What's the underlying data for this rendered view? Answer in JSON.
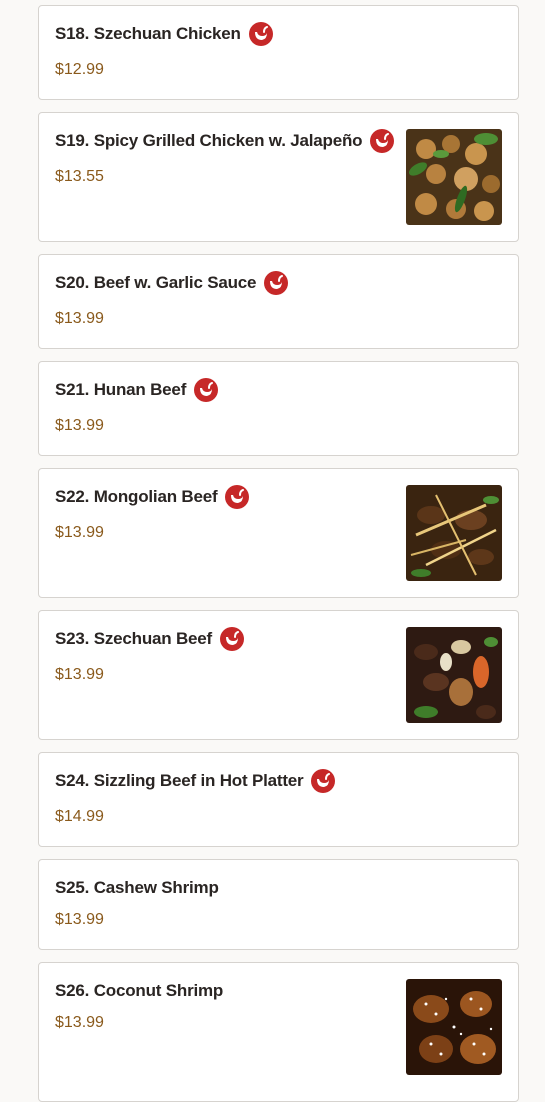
{
  "colors": {
    "accent_price": "#8a5a1c",
    "spicy_red": "#c62828",
    "title": "#2a2523"
  },
  "items": [
    {
      "title": "S18. Szechuan Chicken",
      "price": "$12.99",
      "spicy": true,
      "image": false
    },
    {
      "title": "S19. Spicy Grilled Chicken w. Jalapeño",
      "price": "$13.55",
      "spicy": true,
      "image": true,
      "image_name": "chicken-jalapeno-photo"
    },
    {
      "title": "S20. Beef w. Garlic Sauce",
      "price": "$13.99",
      "spicy": true,
      "image": false
    },
    {
      "title": "S21. Hunan Beef",
      "price": "$13.99",
      "spicy": true,
      "image": false
    },
    {
      "title": "S22. Mongolian Beef",
      "price": "$13.99",
      "spicy": true,
      "image": true,
      "image_name": "mongolian-beef-photo"
    },
    {
      "title": "S23. Szechuan Beef",
      "price": "$13.99",
      "spicy": true,
      "image": true,
      "image_name": "szechuan-beef-photo"
    },
    {
      "title": "S24. Sizzling Beef in Hot Platter",
      "price": "$14.99",
      "spicy": true,
      "image": false
    },
    {
      "title": "S25. Cashew Shrimp",
      "price": "$13.99",
      "spicy": false,
      "image": false
    },
    {
      "title": "S26. Coconut Shrimp",
      "price": "$13.99",
      "spicy": false,
      "image": true,
      "image_name": "coconut-shrimp-photo"
    }
  ]
}
